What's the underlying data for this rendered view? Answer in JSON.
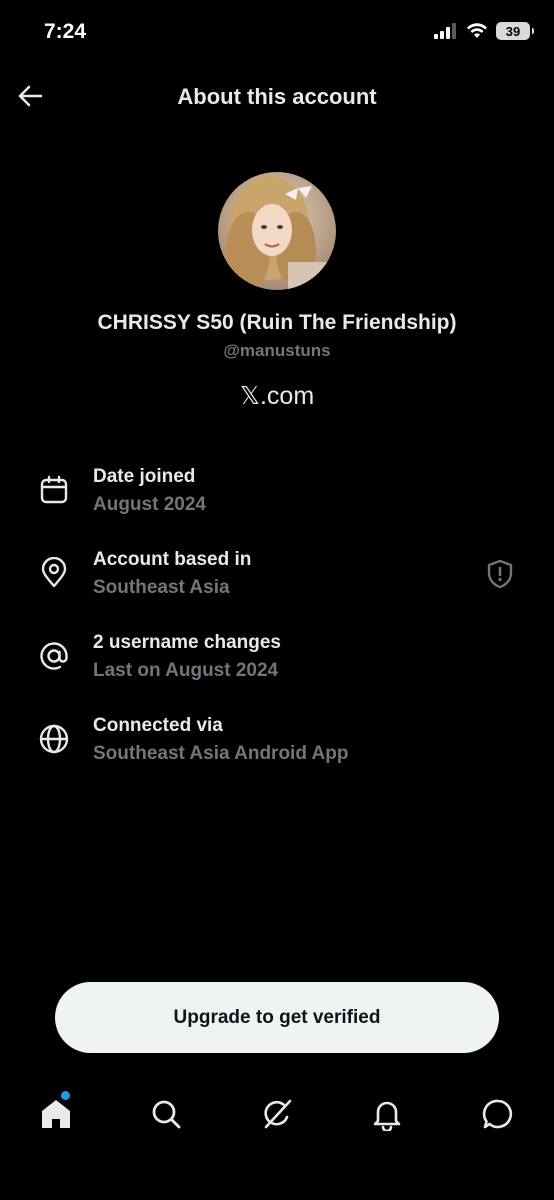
{
  "status": {
    "time": "7:24",
    "battery": "39"
  },
  "header": {
    "title": "About this account",
    "back_icon": "arrow-left-icon"
  },
  "profile": {
    "display_name": "CHRISSY S50 (Ruin The Friendship)",
    "handle": "@manustuns",
    "site": "𝕏.com"
  },
  "info": [
    {
      "icon": "calendar-icon",
      "title": "Date joined",
      "value": "August 2024"
    },
    {
      "icon": "location-pin-icon",
      "title": "Account based in",
      "value": "Southeast Asia"
    },
    {
      "icon": "at-sign-icon",
      "title": "2 username changes",
      "value": "Last on August 2024"
    },
    {
      "icon": "globe-icon",
      "title": "Connected via",
      "value": "Southeast Asia Android App"
    }
  ],
  "upgrade_label": "Upgrade to get verified",
  "tabs": [
    "home-icon",
    "search-icon",
    "grok-icon",
    "notifications-icon",
    "messages-icon"
  ],
  "colors": {
    "background": "#000000",
    "text": "#e7e9ea",
    "muted": "#71767b",
    "accent": "#1d9bf0",
    "button": "#eff3f4"
  }
}
